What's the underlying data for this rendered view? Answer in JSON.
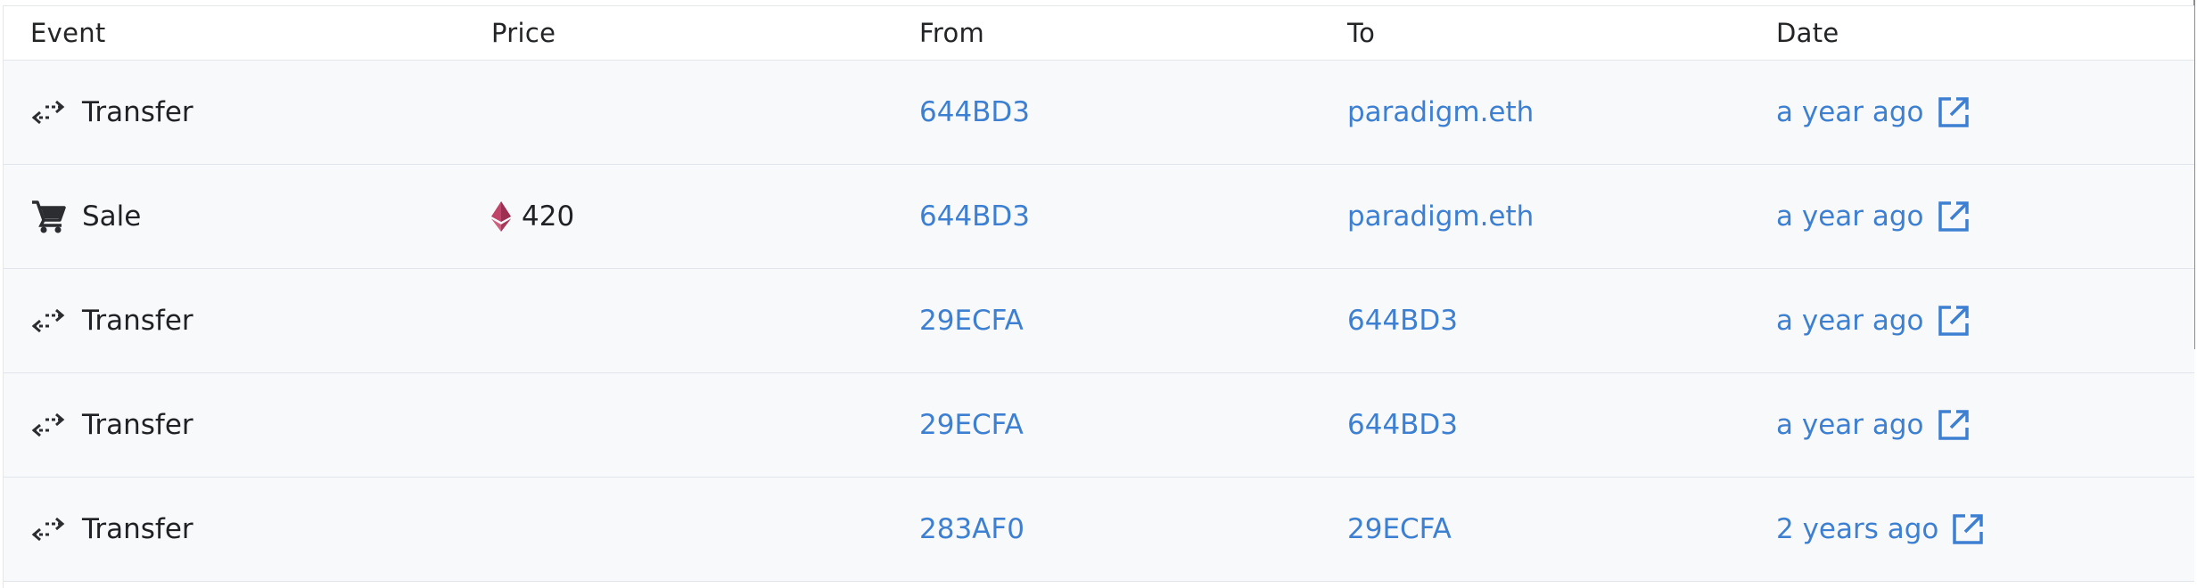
{
  "header": {
    "event": "Event",
    "price": "Price",
    "from": "From",
    "to": "To",
    "date": "Date"
  },
  "rows": [
    {
      "event": "Transfer",
      "event_icon": "transfer-icon",
      "price": "",
      "from": "644BD3",
      "to": "paradigm.eth",
      "date": "a year ago"
    },
    {
      "event": "Sale",
      "event_icon": "cart-icon",
      "price": "420",
      "price_icon": "ethereum-icon",
      "from": "644BD3",
      "to": "paradigm.eth",
      "date": "a year ago"
    },
    {
      "event": "Transfer",
      "event_icon": "transfer-icon",
      "price": "",
      "from": "29ECFA",
      "to": "644BD3",
      "date": "a year ago"
    },
    {
      "event": "Transfer",
      "event_icon": "transfer-icon",
      "price": "",
      "from": "29ECFA",
      "to": "644BD3",
      "date": "a year ago"
    },
    {
      "event": "Transfer",
      "event_icon": "transfer-icon",
      "price": "",
      "from": "283AF0",
      "to": "29ECFA",
      "date": "2 years ago"
    }
  ],
  "colors": {
    "link": "#3d7fd1",
    "text": "#1f2124",
    "ethereum": "#c0446a",
    "row_bg": "#f8f9fb",
    "border": "#e1e4ea"
  }
}
